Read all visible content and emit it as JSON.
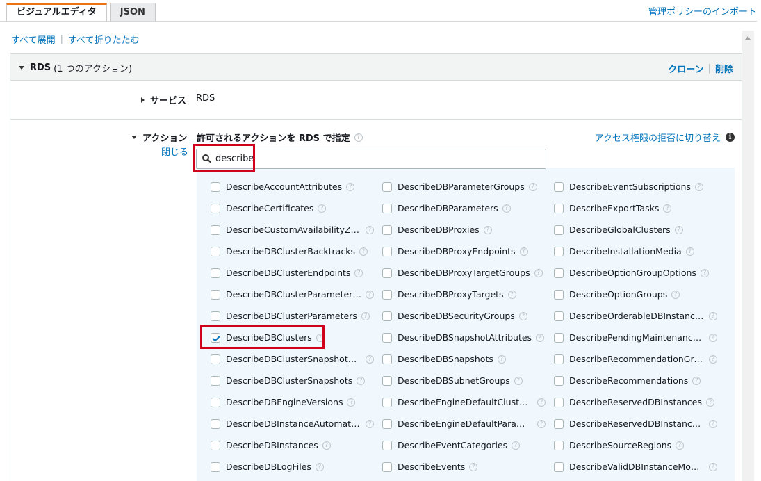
{
  "tabs": [
    {
      "label": "ビジュアルエディタ",
      "active": true
    },
    {
      "label": "JSON",
      "active": false
    }
  ],
  "import_link": "管理ポリシーのインポート",
  "expand_all": "すべて展開",
  "collapse_all": "すべて折りたたむ",
  "panel": {
    "service_name": "RDS",
    "action_count": "(1 つのアクション)",
    "clone": "クローン",
    "delete": "削除"
  },
  "service_row": {
    "label": "サービス",
    "value": "RDS"
  },
  "actions": {
    "label": "アクション",
    "close": "閉じる",
    "heading": "許可されるアクションを RDS で指定",
    "deny_switch": "アクセス権限の拒否に切り替え",
    "search_value": "describe",
    "items": [
      {
        "label": "DescribeAccountAttributes",
        "checked": false
      },
      {
        "label": "DescribeDBParameterGroups",
        "checked": false
      },
      {
        "label": "DescribeEventSubscriptions",
        "checked": false
      },
      {
        "label": "DescribeCertificates",
        "checked": false
      },
      {
        "label": "DescribeDBParameters",
        "checked": false
      },
      {
        "label": "DescribeExportTasks",
        "checked": false
      },
      {
        "label": "DescribeCustomAvailabilityZones",
        "checked": false
      },
      {
        "label": "DescribeDBProxies",
        "checked": false
      },
      {
        "label": "DescribeGlobalClusters",
        "checked": false
      },
      {
        "label": "DescribeDBClusterBacktracks",
        "checked": false
      },
      {
        "label": "DescribeDBProxyEndpoints",
        "checked": false
      },
      {
        "label": "DescribeInstallationMedia",
        "checked": false
      },
      {
        "label": "DescribeDBClusterEndpoints",
        "checked": false
      },
      {
        "label": "DescribeDBProxyTargetGroups",
        "checked": false
      },
      {
        "label": "DescribeOptionGroupOptions",
        "checked": false
      },
      {
        "label": "DescribeDBClusterParameterGro...",
        "checked": false
      },
      {
        "label": "DescribeDBProxyTargets",
        "checked": false
      },
      {
        "label": "DescribeOptionGroups",
        "checked": false
      },
      {
        "label": "DescribeDBClusterParameters",
        "checked": false
      },
      {
        "label": "DescribeDBSecurityGroups",
        "checked": false
      },
      {
        "label": "DescribeOrderableDBInstanceOp...",
        "checked": false
      },
      {
        "label": "DescribeDBClusters",
        "checked": true
      },
      {
        "label": "DescribeDBSnapshotAttributes",
        "checked": false
      },
      {
        "label": "DescribePendingMaintenanceActi...",
        "checked": false
      },
      {
        "label": "DescribeDBClusterSnapshotAttrib...",
        "checked": false
      },
      {
        "label": "DescribeDBSnapshots",
        "checked": false
      },
      {
        "label": "DescribeRecommendationGroups",
        "checked": false
      },
      {
        "label": "DescribeDBClusterSnapshots",
        "checked": false
      },
      {
        "label": "DescribeDBSubnetGroups",
        "checked": false
      },
      {
        "label": "DescribeRecommendations",
        "checked": false
      },
      {
        "label": "DescribeDBEngineVersions",
        "checked": false
      },
      {
        "label": "DescribeEngineDefaultClusterPar...",
        "checked": false
      },
      {
        "label": "DescribeReservedDBInstances",
        "checked": false
      },
      {
        "label": "DescribeDBInstanceAutomatedB...",
        "checked": false
      },
      {
        "label": "DescribeEngineDefaultParameters",
        "checked": false
      },
      {
        "label": "DescribeReservedDBInstancesOf...",
        "checked": false
      },
      {
        "label": "DescribeDBInstances",
        "checked": false
      },
      {
        "label": "DescribeEventCategories",
        "checked": false
      },
      {
        "label": "DescribeSourceRegions",
        "checked": false
      },
      {
        "label": "DescribeDBLogFiles",
        "checked": false
      },
      {
        "label": "DescribeEvents",
        "checked": false
      },
      {
        "label": "DescribeValidDBInstanceModifica...",
        "checked": false
      }
    ]
  },
  "colors": {
    "link": "#0073bb",
    "accent": "#ec7211",
    "highlight": "#d0021b",
    "grid_bg": "#f0f8fd"
  }
}
